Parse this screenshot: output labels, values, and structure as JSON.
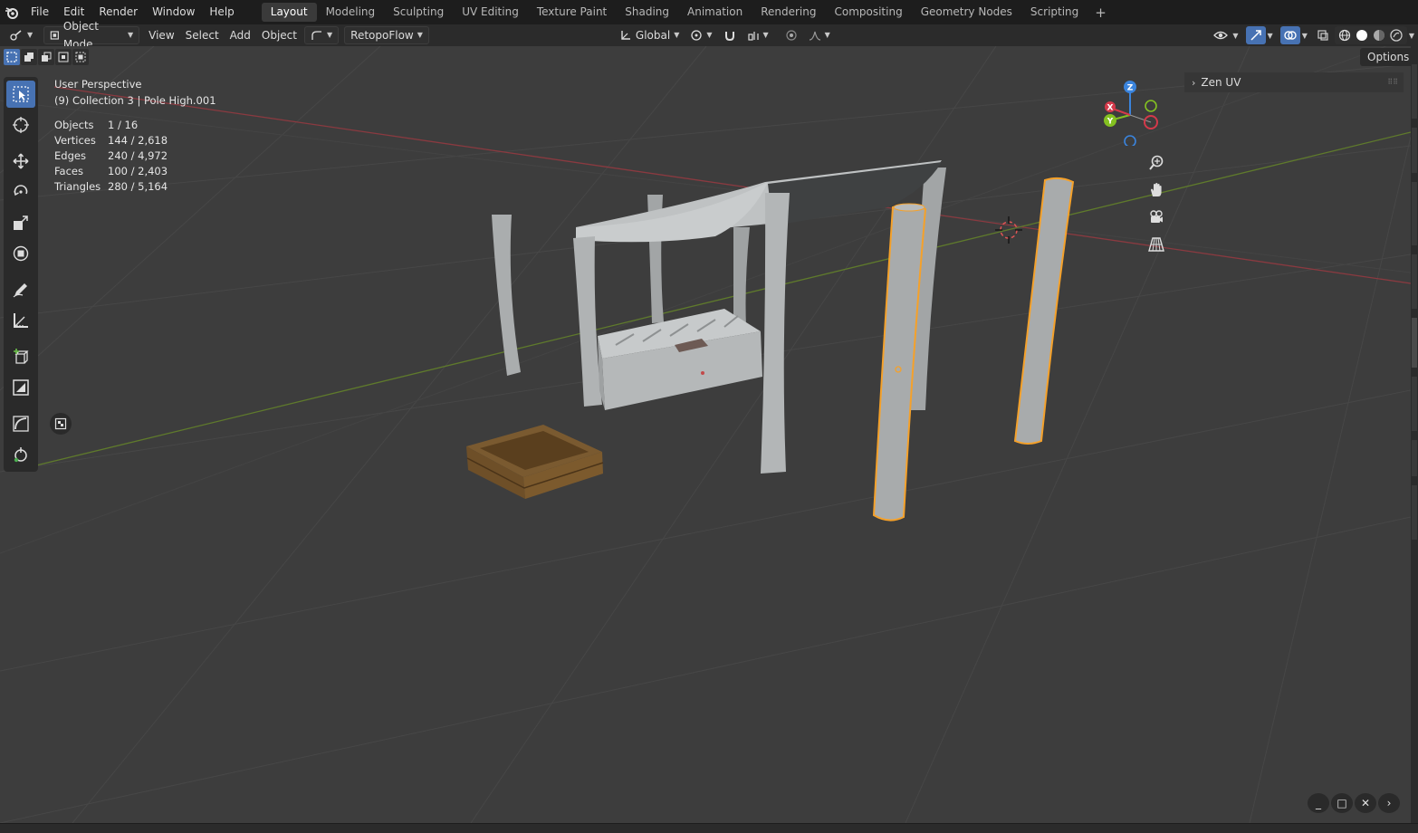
{
  "app": {
    "menu": [
      "File",
      "Edit",
      "Render",
      "Window",
      "Help"
    ]
  },
  "workspaces": {
    "tabs": [
      "Layout",
      "Modeling",
      "Sculpting",
      "UV Editing",
      "Texture Paint",
      "Shading",
      "Animation",
      "Rendering",
      "Compositing",
      "Geometry Nodes",
      "Scripting"
    ],
    "active": "Layout"
  },
  "header": {
    "mode": "Object Mode",
    "menus": [
      "View",
      "Select",
      "Add",
      "Object"
    ],
    "addon_menu": "RetopoFlow",
    "transform_orientation": "Global",
    "options_label": "Options"
  },
  "viewport": {
    "perspective": "User Perspective",
    "collection_info": "(9) Collection 3 | Pole High.001",
    "stats": [
      {
        "label": "Objects",
        "value": "1 / 16"
      },
      {
        "label": "Vertices",
        "value": "144 / 2,618"
      },
      {
        "label": "Edges",
        "value": "240 / 4,972"
      },
      {
        "label": "Faces",
        "value": "100 / 2,403"
      },
      {
        "label": "Triangles",
        "value": "280 / 5,164"
      }
    ],
    "sidebar_panel": "Zen UV",
    "gizmo_axes": {
      "x": "X",
      "y": "Y",
      "z": "Z"
    }
  },
  "colors": {
    "active_blue": "#4772b3",
    "selection_orange": "#f5a12a",
    "axis_x": "#d4394a",
    "axis_y": "#84c121",
    "axis_z": "#3a84dd"
  }
}
